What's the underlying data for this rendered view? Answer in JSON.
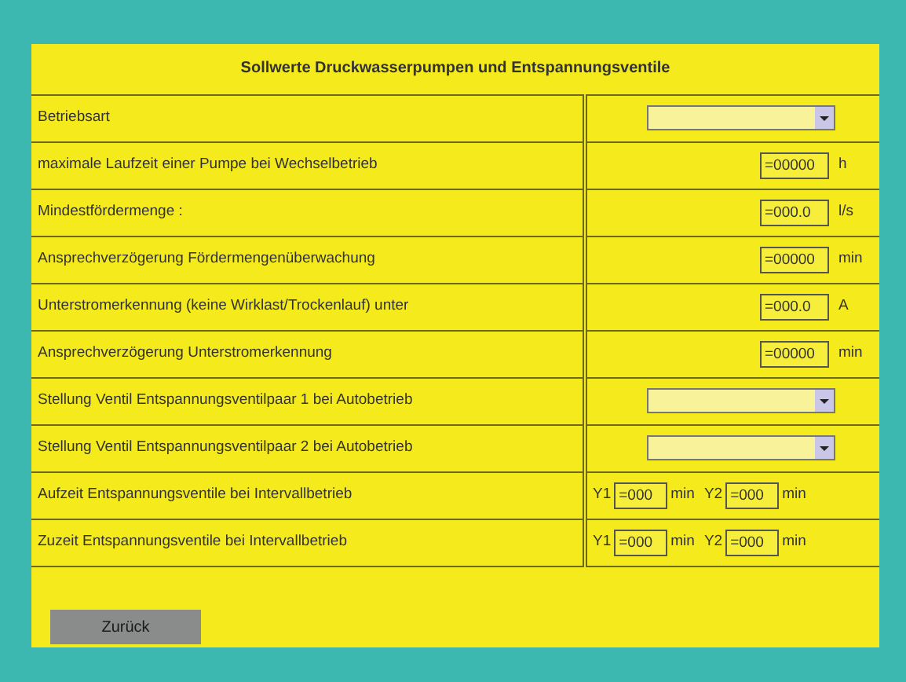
{
  "title": "Sollwerte Druckwasserpumpen und Entspannungsventile",
  "rows": [
    {
      "kind": "select",
      "label": "Betriebsart"
    },
    {
      "kind": "number",
      "label": "maximale Laufzeit einer Pumpe bei Wechselbetrieb",
      "value": "=00000",
      "unit": "h"
    },
    {
      "kind": "number",
      "label": "Mindestfördermenge :",
      "value": "=000.0",
      "unit": "l/s"
    },
    {
      "kind": "number",
      "label": "Ansprechverzögerung Fördermengenüberwachung",
      "value": "=00000",
      "unit": "min"
    },
    {
      "kind": "number",
      "label": "Unterstromerkennung (keine Wirklast/Trockenlauf) unter",
      "value": "=000.0",
      "unit": "A"
    },
    {
      "kind": "number",
      "label": "Ansprechverzögerung Unterstromerkennung",
      "value": "=00000",
      "unit": "min"
    },
    {
      "kind": "select",
      "label": "Stellung Ventil Entspannungsventilpaar 1 bei Autobetrieb"
    },
    {
      "kind": "select",
      "label": "Stellung Ventil Entspannungsventilpaar 2 bei Autobetrieb"
    },
    {
      "kind": "interval",
      "label": "Aufzeit Entspannungsventile bei Intervallbetrieb",
      "prefix1": "Y1",
      "value1": "=000",
      "unit1": "min",
      "prefix2": "Y2",
      "value2": "=000",
      "unit2": "min"
    },
    {
      "kind": "interval",
      "label": "Zuzeit Entspannungsventile bei Intervallbetrieb",
      "prefix1": "Y1",
      "value1": "=000",
      "unit1": "min",
      "prefix2": "Y2",
      "value2": "=000",
      "unit2": "min"
    }
  ],
  "back_button": "Zurück"
}
